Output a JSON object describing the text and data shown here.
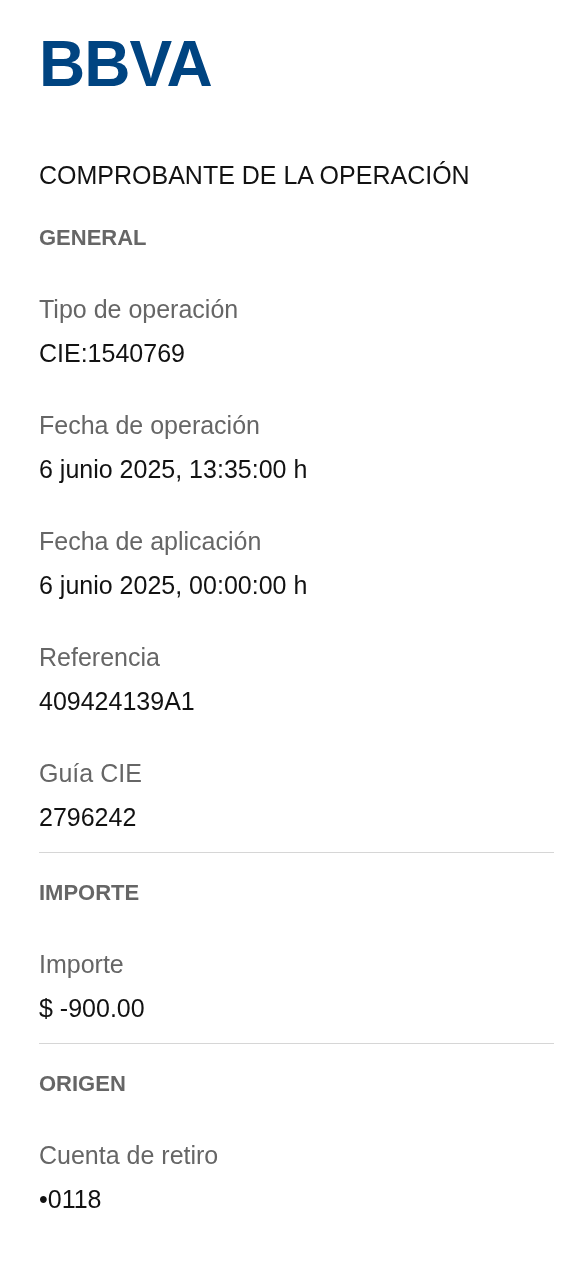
{
  "logo": "BBVA",
  "title": "COMPROBANTE DE LA OPERACIÓN",
  "sections": [
    {
      "heading": "GENERAL",
      "fields": [
        {
          "label": "Tipo de operación",
          "value": "CIE:1540769"
        },
        {
          "label": "Fecha de operación",
          "value": "6 junio 2025, 13:35:00 h"
        },
        {
          "label": "Fecha de aplicación",
          "value": "6 junio 2025, 00:00:00 h"
        },
        {
          "label": "Referencia",
          "value": "409424139A1"
        },
        {
          "label": "Guía CIE",
          "value": "2796242"
        }
      ]
    },
    {
      "heading": "IMPORTE",
      "fields": [
        {
          "label": "Importe",
          "value": "$ -900.00"
        }
      ]
    },
    {
      "heading": "ORIGEN",
      "fields": [
        {
          "label": "Cuenta de retiro",
          "value": "•0118"
        }
      ]
    }
  ]
}
